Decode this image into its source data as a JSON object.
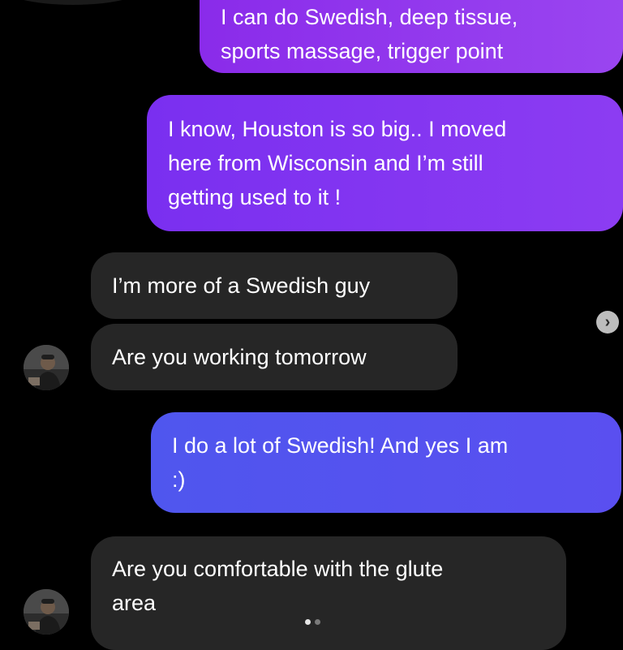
{
  "messages": [
    {
      "id": "b1",
      "side": "sent",
      "text": "I can do Swedish, deep tissue,\nsports massage, trigger point"
    },
    {
      "id": "b2",
      "side": "sent",
      "text": "I know, Houston is so big.. I moved\nhere from Wisconsin and I’m still\ngetting used to it !"
    },
    {
      "id": "b3",
      "side": "received",
      "text": "I’m more of a Swedish guy"
    },
    {
      "id": "b4",
      "side": "received",
      "text": "Are you working tomorrow"
    },
    {
      "id": "b5",
      "side": "sent",
      "text": "I do a lot of Swedish! And yes I am\n:)"
    },
    {
      "id": "b6",
      "side": "received",
      "text": "Are you comfortable with the glute\narea"
    }
  ],
  "colors": {
    "background": "#000000",
    "received_bubble": "#262626",
    "sent_bubble_purple": "#8a2bea",
    "sent_bubble_blue": "#4f56ee"
  },
  "icons": {
    "next": "chevron-right-icon"
  },
  "pager": {
    "count": 2,
    "active_index": 0
  }
}
